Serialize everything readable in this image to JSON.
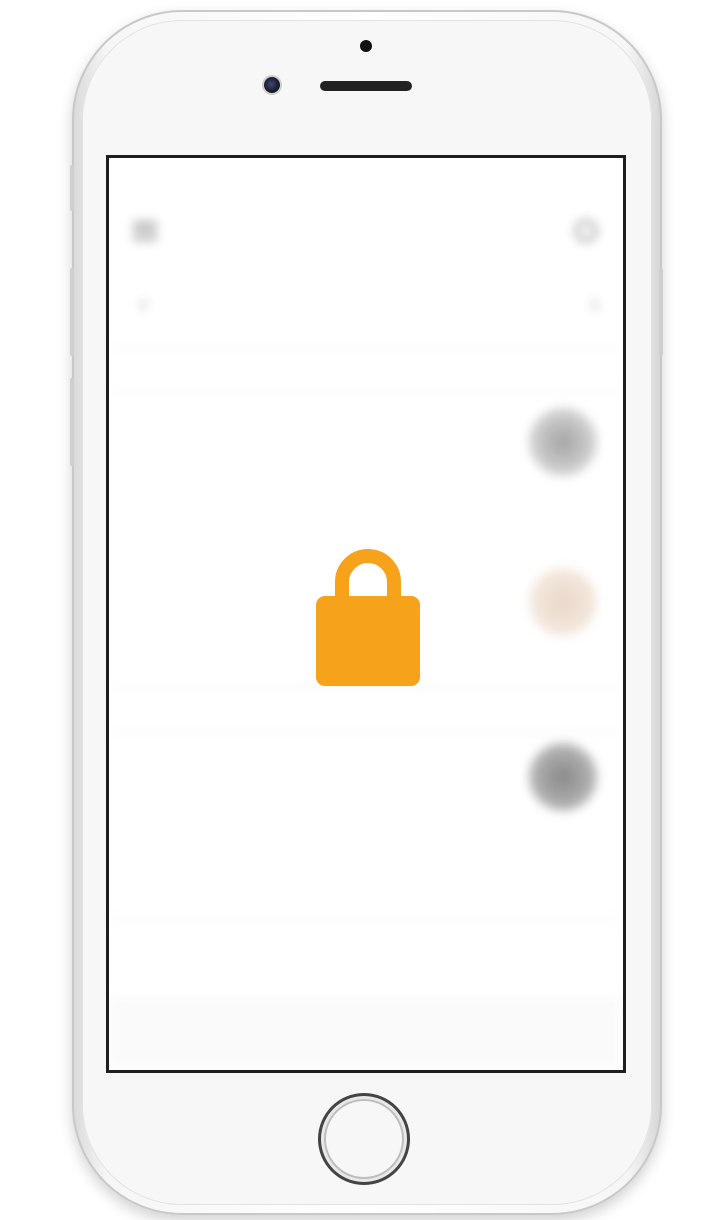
{
  "device": {
    "name": "phone"
  },
  "app": {
    "status_bar": {
      "carrier": "",
      "time": "",
      "battery": ""
    },
    "nav": {
      "title": "",
      "subtitle": ""
    },
    "period_label": "",
    "sections": [
      {
        "header": ""
      },
      {
        "header": ""
      },
      {
        "header": ""
      }
    ],
    "rows": [
      {
        "amount": "",
        "subtitle": ""
      },
      {
        "amount": "",
        "subtitle": ""
      },
      {
        "amount": "",
        "subtitle": ""
      }
    ],
    "tabbar": {
      "left_label": "",
      "right_label": ""
    }
  },
  "overlay": {
    "icon": "lock-icon",
    "color": "#F7A21B",
    "blurred_background": true
  },
  "colors": {
    "lock": "#F7A21B",
    "screen_border": "#1E1E1E"
  }
}
